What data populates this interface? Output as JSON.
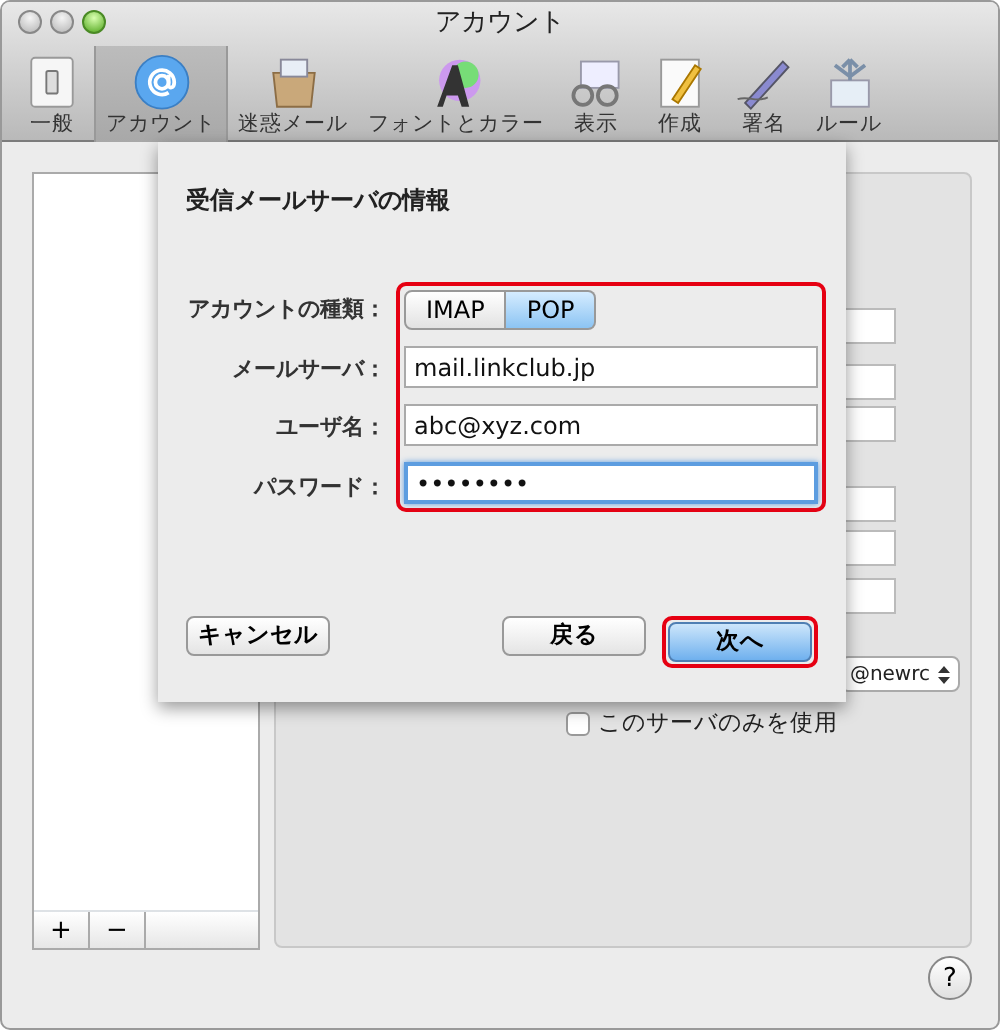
{
  "window": {
    "title": "アカウント"
  },
  "toolbar": [
    {
      "label": "一般",
      "selected": false
    },
    {
      "label": "アカウント",
      "selected": true
    },
    {
      "label": "迷惑メール",
      "selected": false
    },
    {
      "label": "フォントとカラー",
      "selected": false
    },
    {
      "label": "表示",
      "selected": false
    },
    {
      "label": "作成",
      "selected": false
    },
    {
      "label": "署名",
      "selected": false
    },
    {
      "label": "ルール",
      "selected": false
    }
  ],
  "sidebar": {
    "buttons": [
      "+",
      "−"
    ]
  },
  "background_panel": {
    "popup_value": "@newrc",
    "checkbox": {
      "label": "このサーバのみを使用",
      "checked": false
    }
  },
  "sheet": {
    "title": "受信メールサーバの情報",
    "account_type": {
      "label": "アカウントの種類：",
      "options": [
        {
          "label": "IMAP",
          "selected": false
        },
        {
          "label": "POP",
          "selected": true
        }
      ]
    },
    "fields": [
      {
        "label": "メールサーバ：",
        "value": "mail.linkclub.jp",
        "focused": false
      },
      {
        "label": "ユーザ名：",
        "value": "abc@xyz.com",
        "focused": false
      },
      {
        "label": "パスワード：",
        "value": "••••••••",
        "focused": true
      }
    ],
    "buttons": [
      {
        "label": "キャンセル",
        "kind": "left",
        "highlighted": false
      },
      {
        "label": "戻る",
        "kind": "right",
        "highlighted": false
      },
      {
        "label": "次へ",
        "kind": "right",
        "highlighted": true
      }
    ]
  },
  "help_button": "?"
}
